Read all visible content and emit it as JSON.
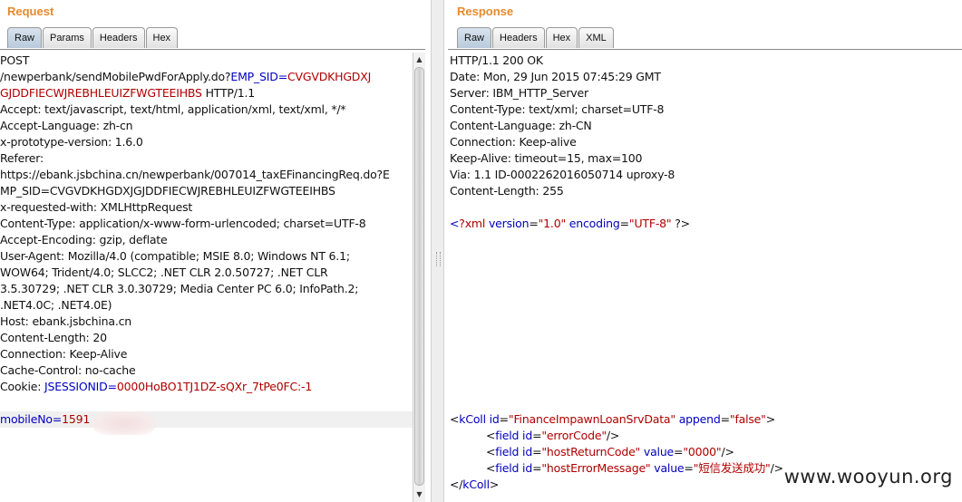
{
  "request": {
    "title": "Request",
    "tabs": [
      "Raw",
      "Params",
      "Headers",
      "Hex"
    ],
    "lines": [
      "POST",
      "/newperbank/sendMobilePwdForApply.do?EMP_SID=CVGVDKHGDXJ",
      "GJDDFIECWJREBHLEUIZFWGTEEIHBS HTTP/1.1",
      "Accept: text/javascript, text/html, application/xml, text/xml, */*",
      "Accept-Language: zh-cn",
      "x-prototype-version: 1.6.0",
      "Referer:",
      "https://ebank.jsbchina.cn/newperbank/007014_taxEFinancingReq.do?E",
      "MP_SID=CVGVDKHGDXJGJDDFIECWJREBHLEUIZFWGTEEIHBS",
      "x-requested-with: XMLHttpRequest",
      "Content-Type: application/x-www-form-urlencoded; charset=UTF-8",
      "Accept-Encoding: gzip, deflate",
      "User-Agent: Mozilla/4.0 (compatible; MSIE 8.0; Windows NT 6.1;",
      "WOW64; Trident/4.0; SLCC2; .NET CLR 2.0.50727; .NET CLR",
      "3.5.30729; .NET CLR 3.0.30729; Media Center PC 6.0; InfoPath.2;",
      ".NET4.0C; .NET4.0E)",
      "Host: ebank.jsbchina.cn",
      "Content-Length: 20",
      "Connection: Keep-Alive",
      "Cache-Control: no-cache"
    ],
    "url_line1": {
      "path": "/newperbank/sendMobilePwdForApply.do?",
      "param": "EMP_SID",
      "eq": "=",
      "value": "CVGVDKHGDXJ"
    },
    "url_line2": {
      "value": "GJDDFIECWJREBHLEUIZFWGTEEIHBS",
      "rest": " HTTP/1.1"
    },
    "cookie": {
      "label": "Cookie: ",
      "name": "JSESSIONID",
      "eq": "=",
      "value": "0000HoBO1TJ1DZ-sQXr_7tPe0FC:-1"
    },
    "body": {
      "name": "mobileNo",
      "eq": "=",
      "value": "1591"
    }
  },
  "response": {
    "title": "Response",
    "tabs": [
      "Raw",
      "Headers",
      "Hex",
      "XML"
    ],
    "lines": [
      "HTTP/1.1 200 OK",
      "Date: Mon, 29 Jun 2015 07:45:29 GMT",
      "Server: IBM_HTTP_Server",
      "Content-Type: text/xml; charset=UTF-8",
      "Content-Language: zh-CN",
      "Connection: Keep-alive",
      "Keep-Alive: timeout=15, max=100",
      "Via: 1.1 ID-0002262016050714 uproxy-8",
      "Content-Length: 255"
    ],
    "xml_decl": {
      "open": "<",
      "q": "?xml",
      "attr1": "version",
      "val1": "\"1.0\"",
      "attr2": "encoding",
      "val2": "\"UTF-8\"",
      "close": " ?>"
    },
    "kcoll": {
      "tag": "kColl",
      "id_attr": "id",
      "id_val": "\"FinanceImpawnLoanSrvData\"",
      "append_attr": "append",
      "append_val": "\"false\"",
      "fields": [
        {
          "tag": "field",
          "id_val": "\"errorCode\"",
          "value_attr": "",
          "value_val": ""
        },
        {
          "tag": "field",
          "id_val": "\"hostReturnCode\"",
          "value_attr": "value",
          "value_val": "\"0000\""
        },
        {
          "tag": "field",
          "id_val": "\"hostErrorMessage\"",
          "value_attr": "value",
          "value_val": "\"短信发送成功\""
        }
      ],
      "close_tag": "kColl"
    }
  },
  "watermark": "www.wooyun.org",
  "colors": {
    "title": "#e58a2b",
    "param": "#0000c0",
    "value": "#b00000"
  }
}
